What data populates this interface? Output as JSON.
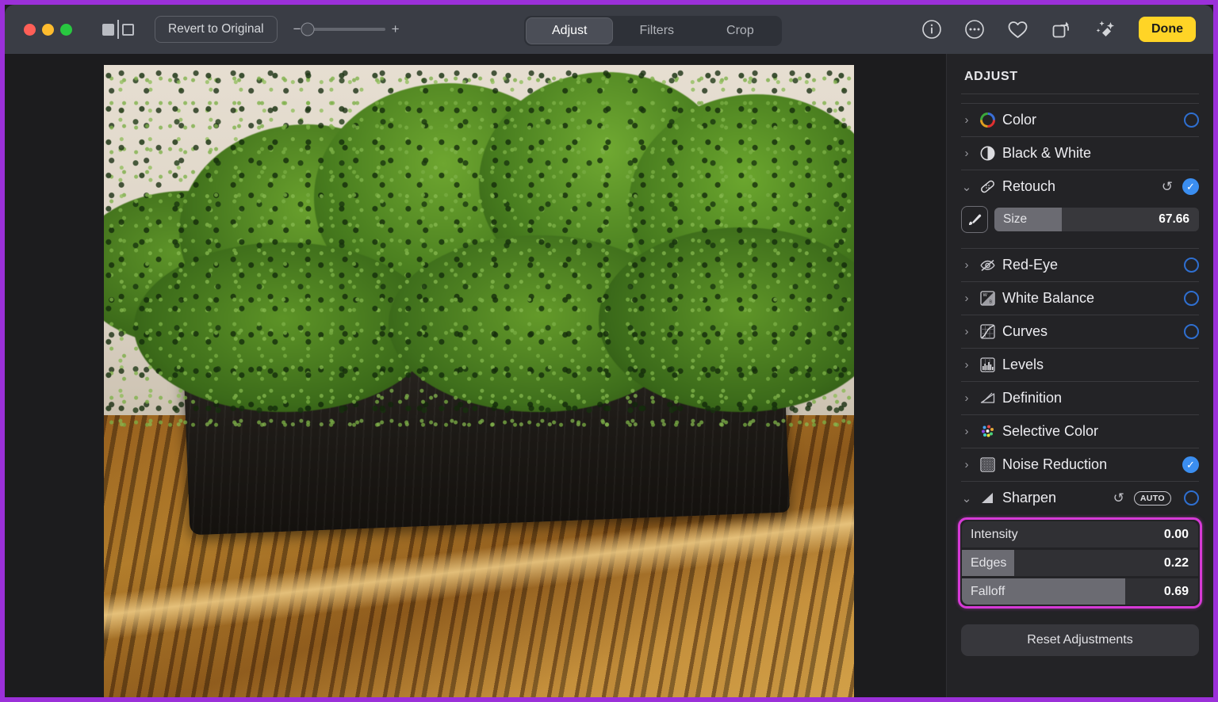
{
  "window": {
    "traffic_lights": [
      "close",
      "minimize",
      "maximize"
    ],
    "split_view_icon": "split-compare-icon",
    "revert_label": "Revert to Original",
    "zoom": {
      "minus": "−",
      "plus": "+",
      "position_pct": 2
    }
  },
  "tabs": [
    {
      "label": "Adjust",
      "active": true
    },
    {
      "label": "Filters",
      "active": false
    },
    {
      "label": "Crop",
      "active": false
    }
  ],
  "toolbar_icons": [
    {
      "name": "info-icon",
      "glyph": "i"
    },
    {
      "name": "more-options-icon",
      "glyph": "⋯"
    },
    {
      "name": "favorite-heart-icon",
      "glyph": "♡"
    },
    {
      "name": "rotate-icon",
      "glyph": "↷"
    },
    {
      "name": "auto-enhance-icon",
      "glyph": "✨"
    }
  ],
  "done_label": "Done",
  "sidebar": {
    "title": "ADJUST",
    "items": [
      {
        "label": "Color",
        "icon": "color-wheel-icon",
        "expanded": false,
        "toggle": "empty"
      },
      {
        "label": "Black & White",
        "icon": "black-white-circle-icon",
        "expanded": false,
        "toggle": "none"
      },
      {
        "label": "Retouch",
        "icon": "bandage-icon",
        "expanded": true,
        "toggle": "checked",
        "revert": "↺"
      },
      {
        "label": "Red-Eye",
        "icon": "eye-slash-icon",
        "expanded": false,
        "toggle": "empty"
      },
      {
        "label": "White Balance",
        "icon": "white-balance-icon",
        "expanded": false,
        "toggle": "empty"
      },
      {
        "label": "Curves",
        "icon": "curves-icon",
        "expanded": false,
        "toggle": "empty"
      },
      {
        "label": "Levels",
        "icon": "levels-icon",
        "expanded": false,
        "toggle": "none"
      },
      {
        "label": "Definition",
        "icon": "definition-icon",
        "expanded": false,
        "toggle": "none"
      },
      {
        "label": "Selective Color",
        "icon": "selective-color-icon",
        "expanded": false,
        "toggle": "none"
      },
      {
        "label": "Noise Reduction",
        "icon": "noise-reduction-icon",
        "expanded": false,
        "toggle": "checked"
      },
      {
        "label": "Sharpen",
        "icon": "sharpen-icon",
        "expanded": true,
        "toggle": "empty",
        "revert": "↺",
        "auto_badge": "AUTO"
      }
    ],
    "retouch_slider": {
      "icon": "brush-icon",
      "name": "Size",
      "value": "67.66",
      "fill_pct": 33
    },
    "sharpen_sliders": [
      {
        "name": "Intensity",
        "value": "0.00",
        "fill_pct": 0
      },
      {
        "name": "Edges",
        "value": "0.22",
        "fill_pct": 22
      },
      {
        "name": "Falloff",
        "value": "0.69",
        "fill_pct": 69
      }
    ],
    "reset_label": "Reset Adjustments",
    "highlight_color": "#d63ad6"
  },
  "photo": {
    "description": "Green reindeer moss arrangement in a dark rectangular planter on a wooden table",
    "wall_color": "#ddd4c6",
    "moss_color": "#4a7a22",
    "planter_color": "#1d1a16",
    "table_color": "#a8711f"
  }
}
